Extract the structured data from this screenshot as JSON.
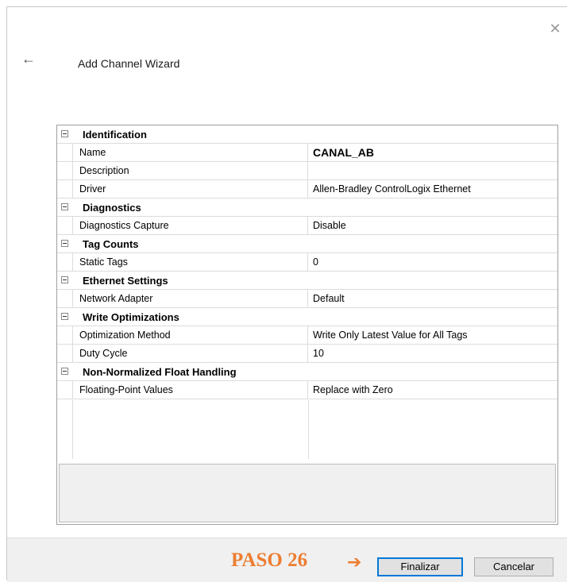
{
  "window": {
    "title": "Add Channel Wizard",
    "close_icon": "close-icon",
    "back_icon": "back-arrow-icon"
  },
  "properties": [
    {
      "type": "category",
      "label": "Identification"
    },
    {
      "type": "property",
      "name": "Name",
      "value": "CANAL_AB",
      "bold": true
    },
    {
      "type": "property",
      "name": "Description",
      "value": ""
    },
    {
      "type": "property",
      "name": "Driver",
      "value": "Allen-Bradley ControlLogix Ethernet"
    },
    {
      "type": "category",
      "label": "Diagnostics"
    },
    {
      "type": "property",
      "name": "Diagnostics Capture",
      "value": "Disable"
    },
    {
      "type": "category",
      "label": "Tag Counts"
    },
    {
      "type": "property",
      "name": "Static Tags",
      "value": "0"
    },
    {
      "type": "category",
      "label": "Ethernet Settings"
    },
    {
      "type": "property",
      "name": "Network Adapter",
      "value": "Default"
    },
    {
      "type": "category",
      "label": "Write Optimizations"
    },
    {
      "type": "property",
      "name": "Optimization Method",
      "value": "Write Only Latest Value for All Tags"
    },
    {
      "type": "property",
      "name": "Duty Cycle",
      "value": "10"
    },
    {
      "type": "category",
      "label": "Non-Normalized Float Handling"
    },
    {
      "type": "property",
      "name": "Floating-Point Values",
      "value": "Replace with Zero"
    }
  ],
  "footer": {
    "annotation": "PASO 26",
    "annotation_arrow": "➔",
    "annotation_color": "#ed7d31",
    "finish_label": "Finalizar",
    "cancel_label": "Cancelar"
  }
}
